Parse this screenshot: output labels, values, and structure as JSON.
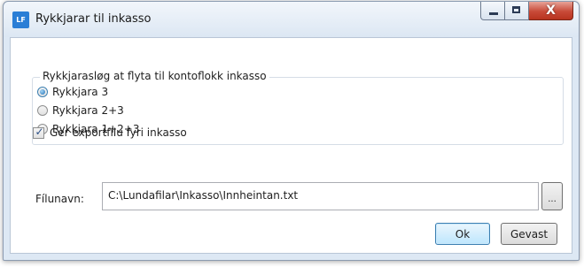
{
  "window": {
    "title": "Rykkjarar til inkasso",
    "app_icon_text": "LF",
    "minimize_icon": "minimize-icon",
    "maximize_icon": "maximize-icon",
    "close_icon": "close-icon",
    "close_glyph": "X"
  },
  "group": {
    "legend": "Rykkjarasløg at flyta til kontoflokk inkasso",
    "options": [
      {
        "label": "Rykkjara 3",
        "checked": true
      },
      {
        "label": "Rykkjara 2+3",
        "checked": false
      },
      {
        "label": "Rykkjara 1+2+3",
        "checked": false
      }
    ]
  },
  "export": {
    "label": "Ger exportfílu fyri inkasso",
    "checked": true,
    "check_glyph": "✓"
  },
  "file": {
    "label": "Fílunavn:",
    "value": "C:\\Lundafilar\\Inkasso\\Innheintan.txt",
    "browse_label": "..."
  },
  "buttons": {
    "ok": "Ok",
    "cancel": "Gevast"
  },
  "colors": {
    "accent": "#3c7fb1",
    "close_button": "#c84a38"
  }
}
